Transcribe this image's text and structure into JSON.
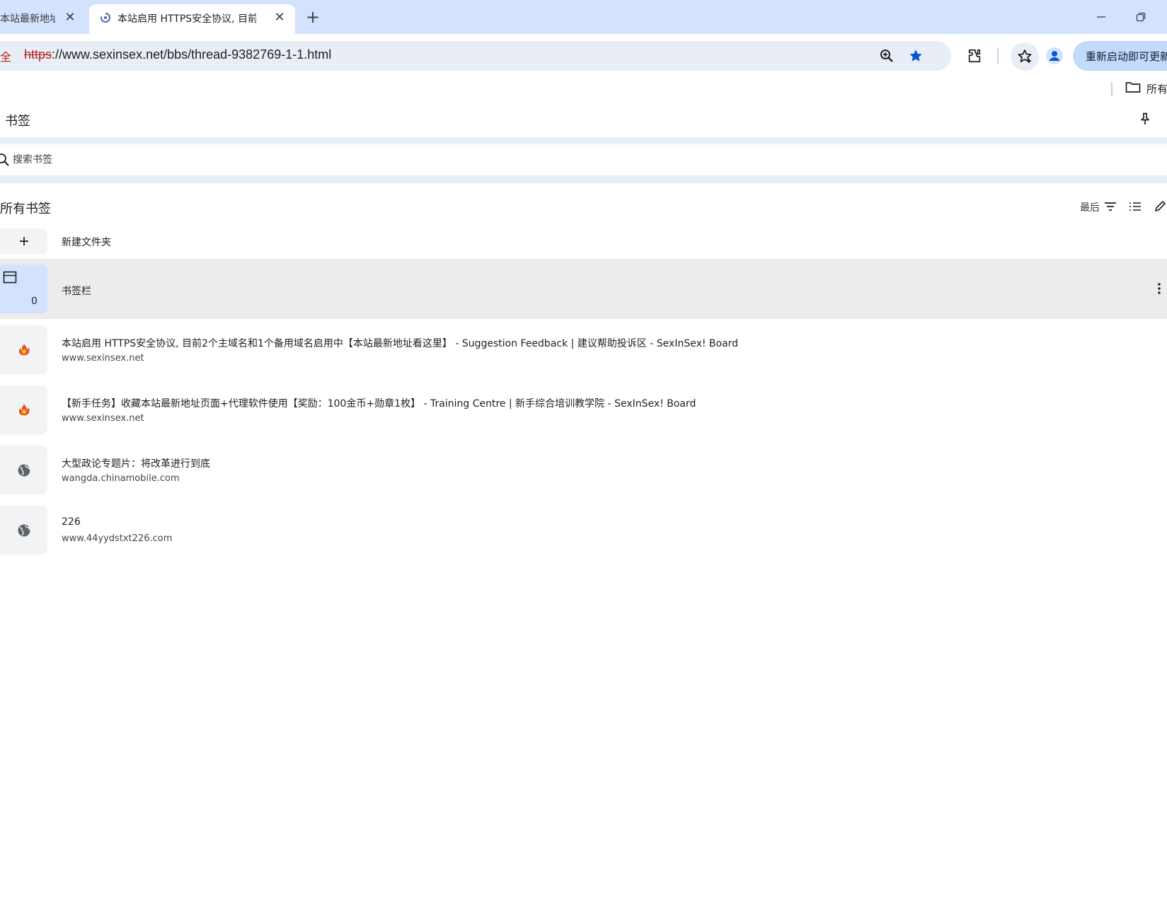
{
  "tabs": [
    {
      "title": "本站最新地址",
      "active": false
    },
    {
      "title": "本站启用 HTTPS安全协议, 目前",
      "active": true
    }
  ],
  "omnibox": {
    "security_label": "全",
    "url_scheme": "https",
    "url_rest": "://www.sexinsex.net/bbs/thread-9382769-1-1.html"
  },
  "toolbar": {
    "restart_label": "重新启动即可更新"
  },
  "bookmarks_bar": {
    "folder_label": "所有"
  },
  "panel": {
    "title": "书签",
    "search_placeholder": "搜索书签",
    "list_title": "所有书签",
    "sort_label": "最后",
    "new_folder_label": "新建文件夹"
  },
  "items": [
    {
      "kind": "folder",
      "title": "书签栏",
      "count": "0"
    },
    {
      "kind": "bookmark",
      "icon": "flame-favicon-icon",
      "title": "本站启用 HTTPS安全协议, 目前2个主域名和1个备用域名启用中【本站最新地址看这里】 - Suggestion Feedback | 建议帮助投诉区 - SexInSex! Board",
      "url": "www.sexinsex.net"
    },
    {
      "kind": "bookmark",
      "icon": "flame-favicon-icon",
      "title": "【新手任务】收藏本站最新地址页面+代理软件使用【奖励：100金币+勋章1枚】 - Training Centre | 新手综合培训教学院 - SexInSex! Board",
      "url": "www.sexinsex.net"
    },
    {
      "kind": "bookmark",
      "icon": "globe-icon",
      "title": "大型政论专题片：将改革进行到底",
      "url": "wangda.chinamobile.com"
    },
    {
      "kind": "bookmark",
      "icon": "globe-icon",
      "title": "226",
      "url": "www.44yydstxt226.com"
    }
  ],
  "colors": {
    "tabstrip": "#d3e3fd",
    "omnibox": "#e9eef6",
    "accent": "#0b57d0",
    "insecure": "#b3261e",
    "restart_button": "#c2dbfb",
    "folder_tile": "#d3e3fd",
    "row_highlight": "#ececec"
  }
}
